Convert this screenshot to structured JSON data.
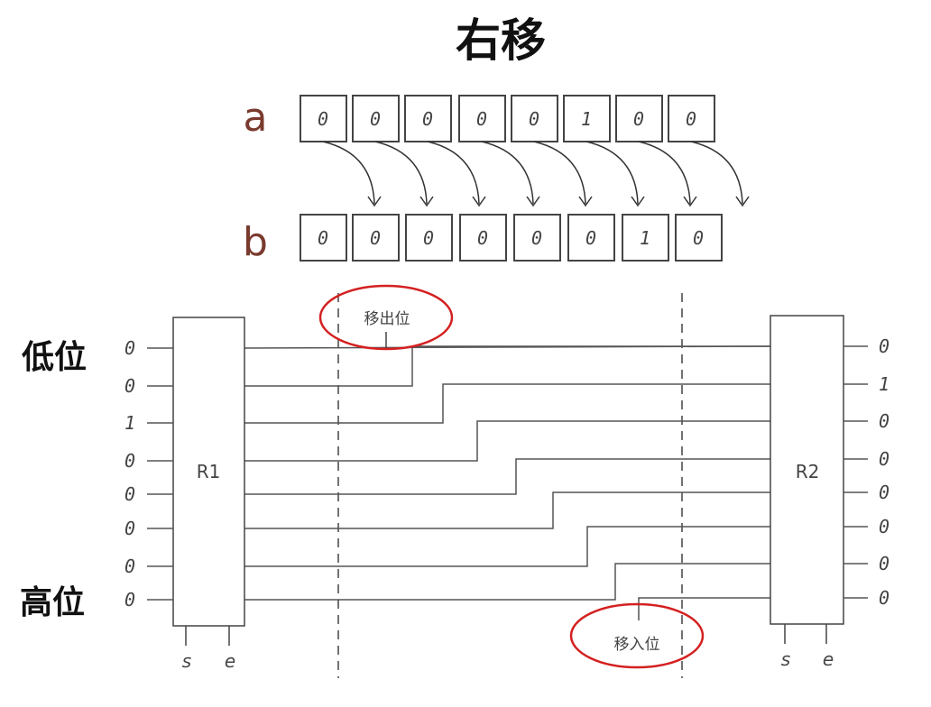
{
  "title": "右移",
  "register_a": {
    "label": "a",
    "bits": [
      "0",
      "0",
      "0",
      "0",
      "0",
      "1",
      "0",
      "0"
    ]
  },
  "register_b": {
    "label": "b",
    "bits": [
      "0",
      "0",
      "0",
      "0",
      "0",
      "0",
      "1",
      "0"
    ]
  },
  "circuit": {
    "low_bit_label": "低位",
    "high_bit_label": "高位",
    "r1": {
      "name": "R1",
      "inputs": [
        "0",
        "0",
        "1",
        "0",
        "0",
        "0",
        "0",
        "0"
      ],
      "pins": [
        "s",
        "e"
      ]
    },
    "r2": {
      "name": "R2",
      "outputs": [
        "0",
        "1",
        "0",
        "0",
        "0",
        "0",
        "0",
        "0"
      ],
      "pins": [
        "s",
        "e"
      ]
    },
    "shift_out_label": "移出位",
    "shift_in_label": "移入位",
    "highlight_color": "#d42020"
  }
}
